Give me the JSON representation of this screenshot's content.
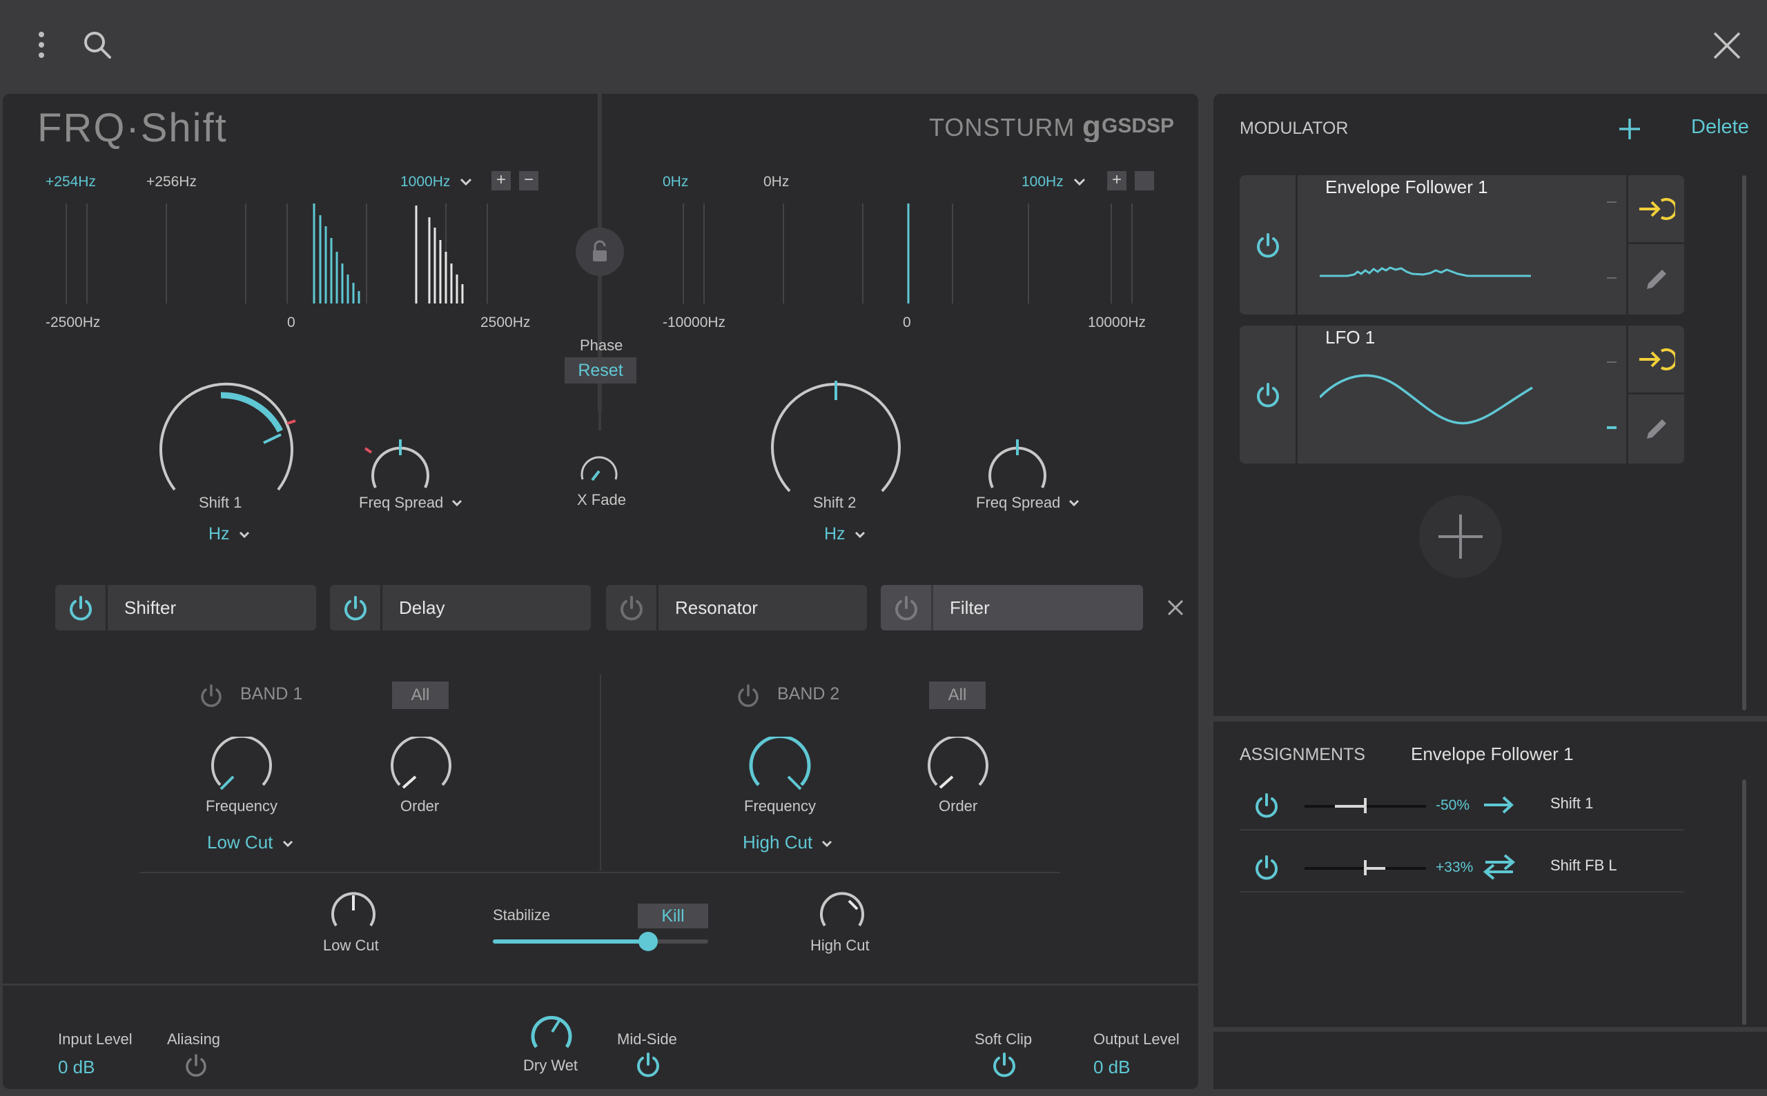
{
  "colors": {
    "accent": "#5fc8d4",
    "yellow": "#f2cf3a",
    "red": "#e2505f",
    "bg": "#3b3b3d",
    "panel": "#2a2a2c"
  },
  "topbar": {
    "menu_icon": "kebab-icon",
    "search_icon": "search-icon",
    "close_icon": "close-icon"
  },
  "brand": {
    "plugin_name": "FRQ·Shift",
    "vendor": "TONSTURM",
    "partner": "GSDSP"
  },
  "spectrum_left": {
    "readout_1": "+254Hz",
    "readout_2": "+256Hz",
    "range": "1000Hz",
    "axis_left": "-2500Hz",
    "axis_center": "0",
    "axis_right": "2500Hz"
  },
  "spectrum_right": {
    "readout_1": "0Hz",
    "readout_2": "0Hz",
    "range": "100Hz",
    "axis_left": "-10000Hz",
    "axis_center": "0",
    "axis_right": "10000Hz"
  },
  "center": {
    "phase_label": "Phase",
    "reset_label": "Reset",
    "xfade_label": "X Fade"
  },
  "knobs_top": {
    "shift1": "Shift 1",
    "shift1_unit": "Hz",
    "freq_spread_1": "Freq Spread",
    "shift2": "Shift 2",
    "shift2_unit": "Hz",
    "freq_spread_2": "Freq Spread"
  },
  "tabs": [
    {
      "label": "Shifter"
    },
    {
      "label": "Delay"
    },
    {
      "label": "Resonator"
    },
    {
      "label": "Filter"
    }
  ],
  "filter": {
    "band1": {
      "title": "BAND 1",
      "all": "All",
      "frequency": "Frequency",
      "order": "Order",
      "type": "Low Cut"
    },
    "band2": {
      "title": "BAND 2",
      "all": "All",
      "frequency": "Frequency",
      "order": "Order",
      "type": "High Cut"
    },
    "low_cut": "Low Cut",
    "stabilize": "Stabilize",
    "kill": "Kill",
    "high_cut": "High Cut",
    "stabilize_value": 0.72
  },
  "footer": {
    "input_level_label": "Input Level",
    "input_level_value": "0 dB",
    "aliasing_label": "Aliasing",
    "dry_wet_label": "Dry Wet",
    "mid_side_label": "Mid-Side",
    "soft_clip_label": "Soft Clip",
    "output_level_label": "Output Level",
    "output_level_value": "0 dB"
  },
  "modulator": {
    "title": "MODULATOR",
    "delete_label": "Delete",
    "items": [
      {
        "name": "Envelope Follower 1"
      },
      {
        "name": "LFO 1"
      }
    ]
  },
  "assignments": {
    "title": "ASSIGNMENTS",
    "source": "Envelope Follower 1",
    "rows": [
      {
        "amount": "-50%",
        "target": "Shift 1",
        "direction": "right-arrow-icon",
        "amount_value": -0.5
      },
      {
        "amount": "+33%",
        "target": "Shift FB L",
        "direction": "bidirectional-arrows-icon",
        "amount_value": 0.33
      }
    ]
  }
}
